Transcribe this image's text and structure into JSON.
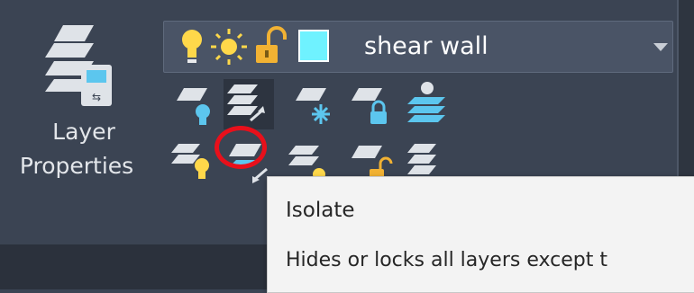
{
  "ribbon": {
    "layer_properties": {
      "label_line1": "Layer",
      "label_line2": "Properties",
      "icon": "layer-properties-icon"
    },
    "layer_dropdown": {
      "current_layer": "shear wall",
      "state_icons": [
        "bulb-on-icon",
        "sun-icon",
        "unlock-icon",
        "color-swatch-icon"
      ],
      "swatch_color": "#6ff2ff",
      "arrow_icon": "chevron-down-icon"
    },
    "tools_row1": [
      "layer-off-icon",
      "isolate-icon",
      "layer-freeze-icon",
      "layer-lock-icon",
      "make-current-icon"
    ],
    "tools_row2": [
      "layer-on-icon",
      "unisolate-icon",
      "thaw-all-icon",
      "unlock-layer-icon",
      "match-layer-icon"
    ]
  },
  "tooltip": {
    "title": "Isolate",
    "description": "Hides or locks all layers except t"
  },
  "colors": {
    "panel_bg": "#3b4453",
    "accent_blue": "#5cc6ee",
    "bulb_yellow": "#ffd84a",
    "highlight_red": "#e8101b"
  }
}
